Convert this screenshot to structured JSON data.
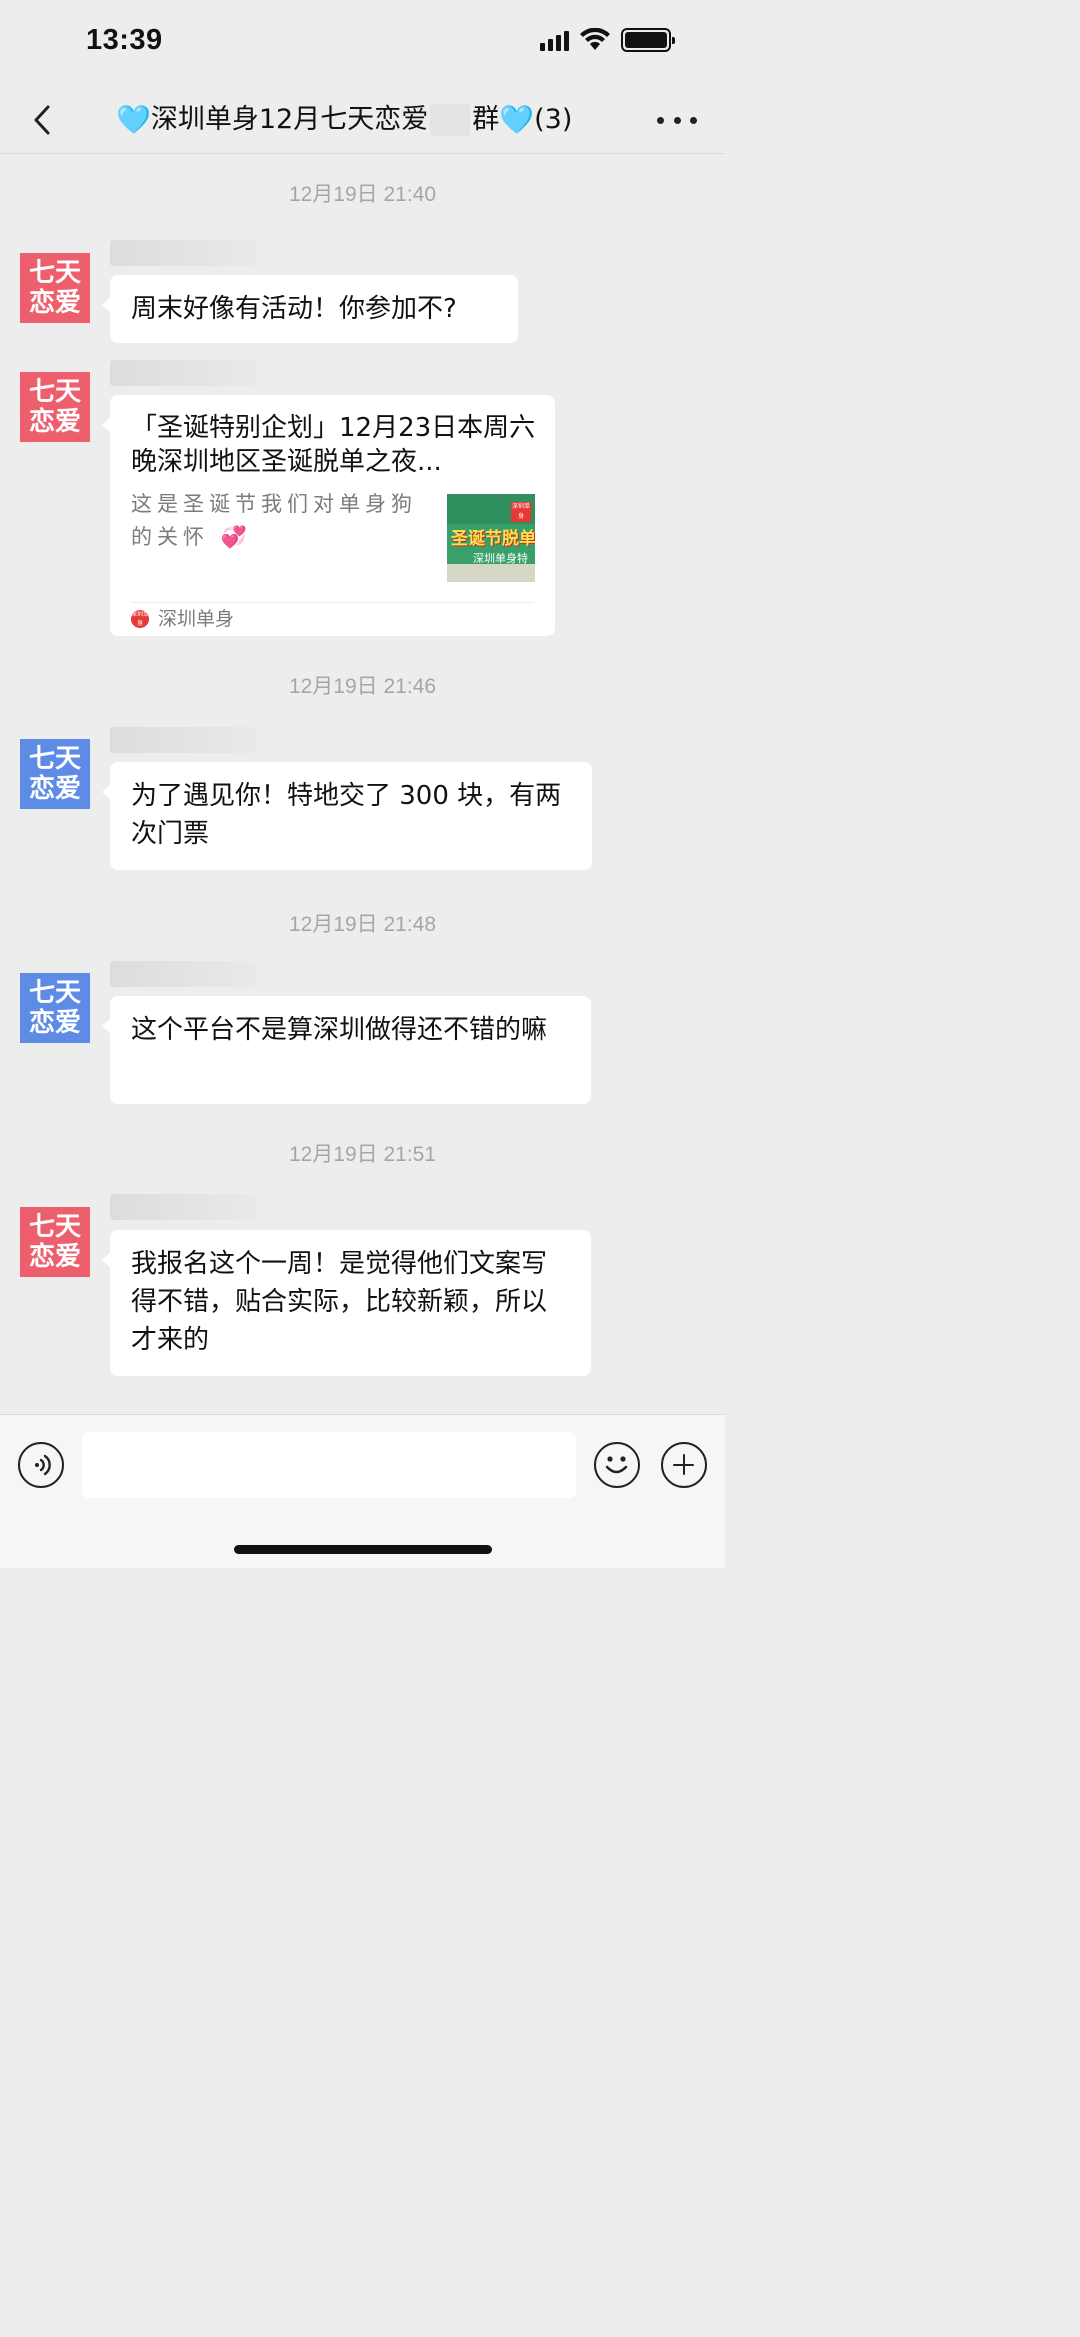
{
  "status_bar": {
    "time": "13:39"
  },
  "nav": {
    "title_main": "深圳单身12月七天恋爱",
    "title_suffix": "群",
    "member_count": "(3)",
    "heart_glyph": "🩵"
  },
  "messages": [
    {
      "timestamp": "12月19日 21:40",
      "avatar_line1": "七天",
      "avatar_line2": "恋爱",
      "avatar_color": "#ee5f6d",
      "text": "周末好像有活动！你参加不?"
    },
    {
      "avatar_line1": "七天",
      "avatar_line2": "恋爱",
      "avatar_color": "#ee5f6d",
      "card": {
        "title": "「圣诞特别企划」12月23日本周六晚深圳地区圣诞脱单之夜...",
        "description": "这是圣诞节我们对单身狗的关怀 💞",
        "thumb_title": "圣诞节脱单",
        "thumb_sub": "深圳单身特",
        "thumb_badge": "深圳单身",
        "source_icon_text": "深圳单身",
        "source": "深圳单身"
      }
    },
    {
      "timestamp": "12月19日 21:46",
      "avatar_line1": "七天",
      "avatar_line2": "恋爱",
      "avatar_color": "#5d8be6",
      "text": "为了遇见你！特地交了 300 块，有两次门票"
    },
    {
      "timestamp": "12月19日 21:48",
      "avatar_line1": "七天",
      "avatar_line2": "恋爱",
      "avatar_color": "#5d8be6",
      "text": "这个平台不是算深圳做得还不错的嘛"
    },
    {
      "timestamp": "12月19日 21:51",
      "avatar_line1": "七天",
      "avatar_line2": "恋爱",
      "avatar_color": "#ee5f6d",
      "text": "我报名这个一周！是觉得他们文案写得不错，贴合实际，比较新颖，所以才来的"
    }
  ],
  "input": {
    "value": "",
    "placeholder": ""
  },
  "icons": [
    "back-arrow-icon",
    "more-dots-icon",
    "voice-icon",
    "emoji-icon",
    "plus-icon",
    "signal-icon",
    "wifi-icon",
    "battery-icon"
  ]
}
